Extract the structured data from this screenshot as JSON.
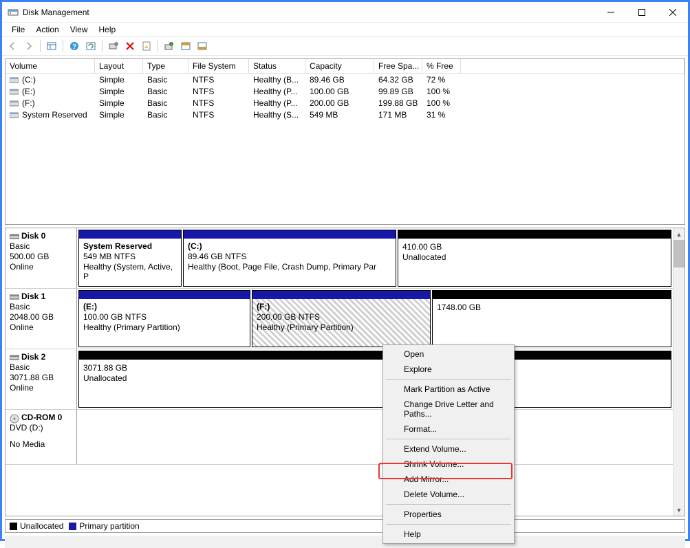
{
  "window": {
    "title": "Disk Management"
  },
  "menu": {
    "file": "File",
    "action": "Action",
    "view": "View",
    "help": "Help"
  },
  "columns": {
    "volume": "Volume",
    "layout": "Layout",
    "type": "Type",
    "fs": "File System",
    "status": "Status",
    "capacity": "Capacity",
    "free": "Free Spa...",
    "pct": "% Free"
  },
  "volumes": [
    {
      "name": "(C:)",
      "layout": "Simple",
      "type": "Basic",
      "fs": "NTFS",
      "status": "Healthy (B...",
      "capacity": "89.46 GB",
      "free": "64.32 GB",
      "pct": "72 %"
    },
    {
      "name": "(E:)",
      "layout": "Simple",
      "type": "Basic",
      "fs": "NTFS",
      "status": "Healthy (P...",
      "capacity": "100.00 GB",
      "free": "99.89 GB",
      "pct": "100 %"
    },
    {
      "name": "(F:)",
      "layout": "Simple",
      "type": "Basic",
      "fs": "NTFS",
      "status": "Healthy (P...",
      "capacity": "200.00 GB",
      "free": "199.88 GB",
      "pct": "100 %"
    },
    {
      "name": "System Reserved",
      "layout": "Simple",
      "type": "Basic",
      "fs": "NTFS",
      "status": "Healthy (S...",
      "capacity": "549 MB",
      "free": "171 MB",
      "pct": "31 %"
    }
  ],
  "disks": {
    "d0": {
      "name": "Disk 0",
      "type": "Basic",
      "size": "500.00 GB",
      "status": "Online",
      "p0": {
        "title": "System Reserved",
        "line2": "549 MB NTFS",
        "line3": "Healthy (System, Active, P"
      },
      "p1": {
        "title": "(C:)",
        "line2": "89.46 GB NTFS",
        "line3": "Healthy (Boot, Page File, Crash Dump, Primary Par"
      },
      "p2": {
        "title": "",
        "line2": "410.00 GB",
        "line3": "Unallocated"
      }
    },
    "d1": {
      "name": "Disk 1",
      "type": "Basic",
      "size": "2048.00 GB",
      "status": "Online",
      "p0": {
        "title": "(E:)",
        "line2": "100.00 GB NTFS",
        "line3": "Healthy (Primary Partition)"
      },
      "p1": {
        "title": "(F:)",
        "line2": "200.00 GB NTFS",
        "line3": "Healthy (Primary Partition)"
      },
      "p2": {
        "title": "",
        "line2": "1748.00 GB",
        "line3": ""
      }
    },
    "d2": {
      "name": "Disk 2",
      "type": "Basic",
      "size": "3071.88 GB",
      "status": "Online",
      "p0": {
        "title": "",
        "line2": "3071.88 GB",
        "line3": "Unallocated"
      }
    },
    "cd": {
      "name": "CD-ROM 0",
      "type": "DVD (D:)",
      "status": "No Media"
    }
  },
  "legend": {
    "unalloc": "Unallocated",
    "primary": "Primary partition"
  },
  "context": {
    "open": "Open",
    "explore": "Explore",
    "mark": "Mark Partition as Active",
    "change": "Change Drive Letter and Paths...",
    "format": "Format...",
    "extend": "Extend Volume...",
    "shrink": "Shrink Volume...",
    "mirror": "Add Mirror...",
    "delete": "Delete Volume...",
    "props": "Properties",
    "help": "Help"
  }
}
